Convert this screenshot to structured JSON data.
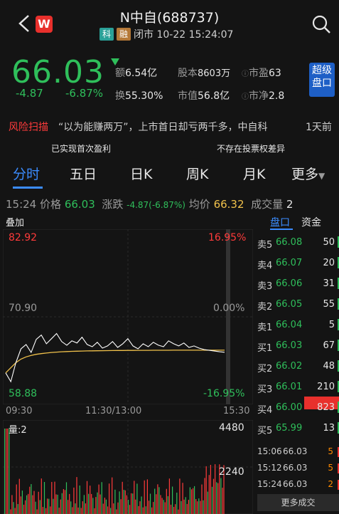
{
  "header": {
    "title": "N中自(688737)",
    "tag_ke": "科",
    "tag_rong": "融",
    "status": "闭市 10-22 15:24:07",
    "app_logo": "W"
  },
  "quote": {
    "price": "66.03",
    "change": "-4.87",
    "change_pct": "-6.87%",
    "amount_label": "额",
    "amount": "6.54亿",
    "turnover_label": "换",
    "turnover": "55.30%",
    "share_cap_label": "股本",
    "share_cap": "8603万",
    "mkt_val_label": "市值",
    "mkt_val": "56.8亿",
    "pe_label": "市盈",
    "pe": "63",
    "pb_label": "市净",
    "pb": "2.8",
    "more_button": "超级盘口"
  },
  "risk": {
    "label": "风险扫描",
    "text": "“以为能赚两万”，上市首日却亏两千多，中自科",
    "days": "1天前",
    "feature1": "已实现首次盈利",
    "feature2": "不存在投票权差异"
  },
  "tabs": [
    "分时",
    "五日",
    "日K",
    "周K",
    "月K",
    "更多"
  ],
  "info_line": {
    "time": "15:24",
    "price_label": "价格",
    "price": "66.03",
    "chg_label": "涨跌",
    "chg": "-4.87(-6.87%)",
    "avg_label": "均价",
    "avg": "66.32",
    "vol_label": "成交量",
    "vol": "2"
  },
  "chart": {
    "stack_label": "叠加",
    "top_left": "82.92",
    "top_right": "16.95%",
    "mid_left": "70.90",
    "mid_right": "0.00%",
    "bot_left": "58.88",
    "bot_right": "-16.95%",
    "time_start": "09:30",
    "time_mid": "11:30/13:00",
    "time_end": "15:30",
    "vol_label": "量:2",
    "vol_top": "4480",
    "vol_mid": "2240",
    "colors": {
      "price": "#ffffff",
      "avg": "#f0c14b",
      "up": "#ff3b3b",
      "down": "#2fbf5b"
    }
  },
  "chart_data": {
    "type": "line",
    "title": "",
    "ylim": [
      58.88,
      82.92
    ],
    "series": [
      {
        "values": [
          63.2,
          62.0,
          64.6,
          66.5,
          67.1,
          66.0,
          67.8,
          68.4,
          67.2,
          67.9,
          68.6,
          67.5,
          67.0,
          67.6,
          67.3,
          68.1,
          67.1,
          66.8,
          67.4,
          66.6,
          66.9,
          67.5,
          66.7,
          67.2,
          67.9,
          66.9,
          66.5,
          67.2,
          66.8,
          67.4,
          67.0,
          66.8,
          67.6,
          67.2,
          66.9,
          67.3,
          66.7,
          66.9,
          66.6,
          66.4,
          66.3,
          66.2,
          66.1,
          66.03
        ]
      },
      {
        "values": [
          63.2,
          63.9,
          64.6,
          65.1,
          65.4,
          65.6,
          65.75,
          65.85,
          65.93,
          66.0,
          66.05,
          66.1,
          66.13,
          66.16,
          66.18,
          66.2,
          66.22,
          66.23,
          66.24,
          66.25,
          66.26,
          66.27,
          66.28,
          66.28,
          66.29,
          66.29,
          66.3,
          66.3,
          66.3,
          66.31,
          66.31,
          66.31,
          66.31,
          66.32,
          66.32,
          66.32,
          66.32,
          66.32,
          66.32,
          66.32,
          66.32,
          66.32,
          66.32,
          66.32
        ]
      }
    ]
  },
  "order_book": {
    "tab1": "盘口",
    "tab2": "资金",
    "rows": [
      {
        "label": "卖5",
        "price": "66.08",
        "vol": "50",
        "dir": "down"
      },
      {
        "label": "卖4",
        "price": "66.07",
        "vol": "20",
        "dir": "down"
      },
      {
        "label": "卖3",
        "price": "66.06",
        "vol": "31",
        "dir": "down"
      },
      {
        "label": "卖2",
        "price": "66.05",
        "vol": "55",
        "dir": "down"
      },
      {
        "label": "卖1",
        "price": "66.04",
        "vol": "5",
        "dir": "down"
      },
      {
        "label": "买1",
        "price": "66.03",
        "vol": "67",
        "dir": "down"
      },
      {
        "label": "买2",
        "price": "66.02",
        "vol": "48",
        "dir": "down"
      },
      {
        "label": "买3",
        "price": "66.01",
        "vol": "210",
        "dir": "down"
      },
      {
        "label": "买4",
        "price": "66.00",
        "vol": "823",
        "dir": "down"
      },
      {
        "label": "买5",
        "price": "65.99",
        "vol": "13",
        "dir": "down"
      }
    ],
    "trades": [
      {
        "time": "15:06",
        "price": "66.03",
        "vol": "5"
      },
      {
        "time": "15:12",
        "price": "66.03",
        "vol": "5"
      },
      {
        "time": "15:24",
        "price": "66.03",
        "vol": "2"
      }
    ],
    "more_trades": "更多成交"
  }
}
